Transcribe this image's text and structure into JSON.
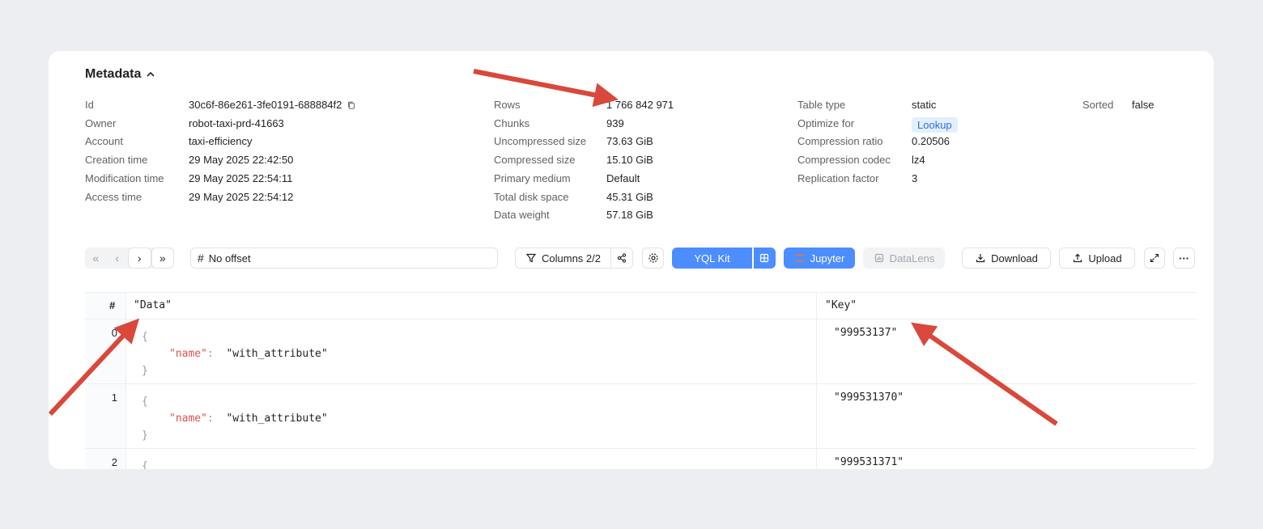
{
  "metadata": {
    "title": "Metadata",
    "col1": [
      {
        "k": "Id",
        "v": "30c6f-86e261-3fe0191-688884f2"
      },
      {
        "k": "Owner",
        "v": "robot-taxi-prd-41663"
      },
      {
        "k": "Account",
        "v": "taxi-efficiency"
      },
      {
        "k": "Creation time",
        "v": "29 May 2025 22:42:50"
      },
      {
        "k": "Modification time",
        "v": "29 May 2025 22:54:11"
      },
      {
        "k": "Access time",
        "v": "29 May 2025 22:54:12"
      }
    ],
    "col2": [
      {
        "k": "Rows",
        "v": "1 766 842 971"
      },
      {
        "k": "Chunks",
        "v": "939"
      },
      {
        "k": "Uncompressed size",
        "v": "73.63 GiB"
      },
      {
        "k": "Compressed size",
        "v": "15.10 GiB"
      },
      {
        "k": "Primary medium",
        "v": "Default"
      },
      {
        "k": "Total disk space",
        "v": "45.31 GiB"
      },
      {
        "k": "Data weight",
        "v": "57.18 GiB"
      }
    ],
    "col3": [
      {
        "k": "Table type",
        "v": "static"
      },
      {
        "k": "Optimize for",
        "v": "Lookup"
      },
      {
        "k": "Compression ratio",
        "v": "0.20506"
      },
      {
        "k": "Compression codec",
        "v": "lz4"
      },
      {
        "k": "Replication factor",
        "v": "3"
      }
    ],
    "col4": [
      {
        "k": "Sorted",
        "v": "false"
      }
    ]
  },
  "toolbar": {
    "pager": [
      "«",
      "‹",
      "›",
      "»"
    ],
    "offset": "No offset",
    "columns": "Columns 2/2",
    "yql": "YQL Kit",
    "jupyter": "Jupyter",
    "datalens": "DataLens",
    "download": "Download",
    "upload": "Upload",
    "more": "···"
  },
  "table": {
    "headers": {
      "index": "#",
      "data": "\"Data\"",
      "key": "\"Key\""
    },
    "rows": [
      {
        "idx": "0",
        "json_key": "\"name\"",
        "json_val": "\"with_attribute\"",
        "key": "\"99953137\""
      },
      {
        "idx": "1",
        "json_key": "\"name\"",
        "json_val": "\"with_attribute\"",
        "key": "\"999531370\""
      },
      {
        "idx": "2",
        "json_key": "",
        "json_val": "",
        "key": "\"999531371\""
      }
    ]
  },
  "colors": {
    "accent": "#4c8dff",
    "arrow": "#d9483b",
    "bg": "#eceef1"
  }
}
